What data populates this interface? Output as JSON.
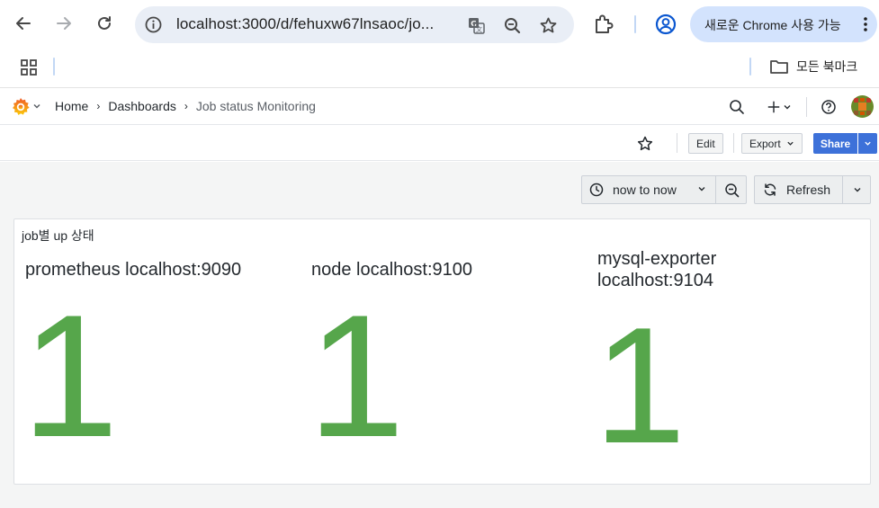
{
  "browser": {
    "url": "localhost:3000/d/fehuxw67lnsaoc/jo...",
    "chrome_promo": "새로운 Chrome 사용 가능",
    "bookmark_folder": "모든 북마크"
  },
  "grafana": {
    "breadcrumbs": [
      {
        "label": "Home"
      },
      {
        "label": "Dashboards"
      },
      {
        "label": "Job status Monitoring"
      }
    ],
    "toolbar": {
      "edit_label": "Edit",
      "export_label": "Export",
      "share_label": "Share"
    },
    "time_picker": {
      "range_label": "now to now",
      "refresh_label": "Refresh"
    },
    "panel": {
      "title": "job별 up 상태",
      "stats": [
        {
          "label_lines": [
            "prometheus localhost:9090"
          ],
          "value": "1"
        },
        {
          "label_lines": [
            "node localhost:9100"
          ],
          "value": "1"
        },
        {
          "label_lines": [
            "mysql-exporter",
            "localhost:9104"
          ],
          "value": "1"
        }
      ]
    }
  },
  "colors": {
    "stat_value": "#56a64b",
    "share_button": "#3d71d9",
    "chrome_pill": "#d3e3fd",
    "dashboard_bg": "#f4f5f5"
  }
}
